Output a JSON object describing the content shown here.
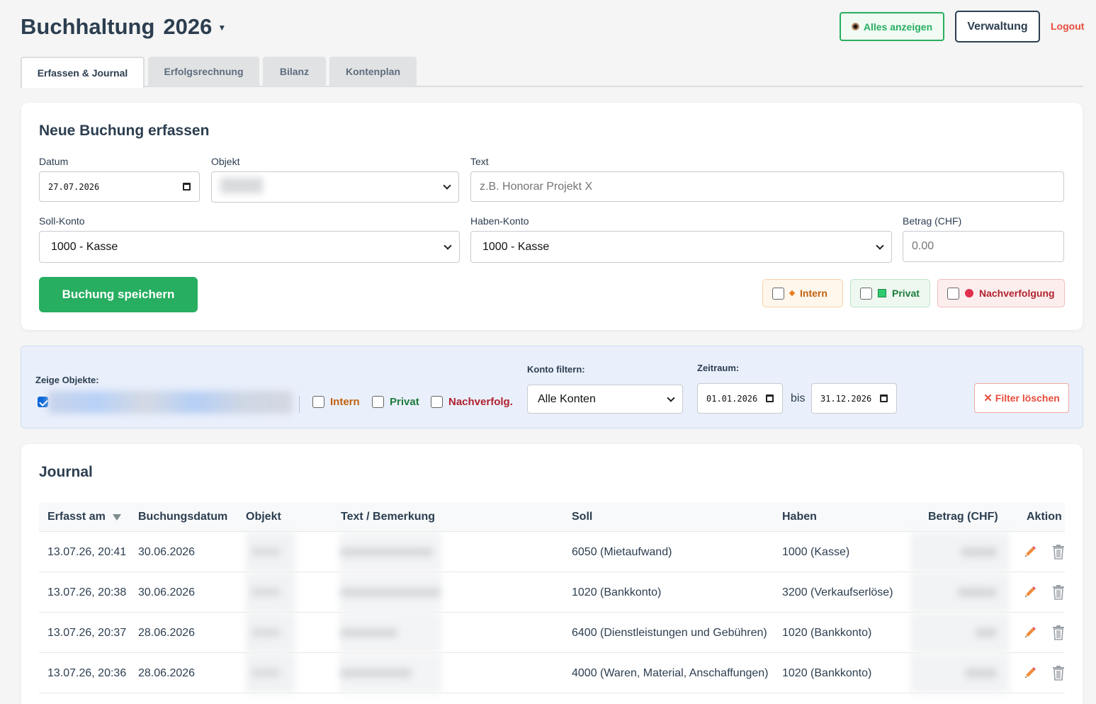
{
  "header": {
    "title": "Buchhaltung",
    "year": "2026",
    "show_all_label": "Alles anzeigen",
    "admin_label": "Verwaltung",
    "logout_label": "Logout"
  },
  "tabs": [
    {
      "label": "Erfassen & Journal",
      "active": true
    },
    {
      "label": "Erfolgsrechnung",
      "active": false
    },
    {
      "label": "Bilanz",
      "active": false
    },
    {
      "label": "Kontenplan",
      "active": false
    }
  ],
  "form": {
    "title": "Neue Buchung erfassen",
    "date_label": "Datum",
    "date_value": "27.07.2026",
    "object_label": "Objekt",
    "text_label": "Text",
    "text_placeholder": "z.B. Honorar Projekt X",
    "debit_label": "Soll-Konto",
    "debit_value": "1000 - Kasse",
    "credit_label": "Haben-Konto",
    "credit_value": "1000 - Kasse",
    "amount_label": "Betrag (CHF)",
    "amount_placeholder": "0.00",
    "save_label": "Buchung speichern",
    "flags": [
      {
        "label": "Intern",
        "color": "#c0620f",
        "bg": "#fff6ec",
        "border": "#f6d3a8"
      },
      {
        "label": "Privat",
        "color": "#1e7b3c",
        "bg": "#eef8f0",
        "border": "#bfe3c8"
      },
      {
        "label": "Nachverfolgung",
        "color": "#b0222e",
        "bg": "#fdeeee",
        "border": "#f2bcbc"
      }
    ]
  },
  "filter": {
    "objects_label": "Zeige Objekte:",
    "intern_label": "Intern",
    "privat_label": "Privat",
    "followup_label": "Nachverfolg.",
    "account_label": "Konto filtern:",
    "account_value": "Alle Konten",
    "period_label": "Zeitraum:",
    "from_date": "01.01.2026",
    "to_label": "bis",
    "to_date": "31.12.2026",
    "clear_label": "Filter löschen"
  },
  "journal": {
    "title": "Journal",
    "columns": [
      "Erfasst am",
      "Buchungsdatum",
      "Objekt",
      "Text / Bemerkung",
      "Soll",
      "Haben",
      "Betrag (CHF)",
      "Aktion"
    ],
    "rows": [
      {
        "created": "13.07.26, 20:41",
        "date": "30.06.2026",
        "debit": "6050 (Mietaufwand)",
        "credit": "1000 (Kasse)"
      },
      {
        "created": "13.07.26, 20:38",
        "date": "30.06.2026",
        "debit": "1020 (Bankkonto)",
        "credit": "3200 (Verkaufserlöse)"
      },
      {
        "created": "13.07.26, 20:37",
        "date": "28.06.2026",
        "debit": "6400 (Dienstleistungen und Gebühren)",
        "credit": "1020 (Bankkonto)"
      },
      {
        "created": "13.07.26, 20:36",
        "date": "28.06.2026",
        "debit": "4000 (Waren, Material, Anschaffungen)",
        "credit": "1020 (Bankkonto)"
      }
    ]
  },
  "colors": {
    "accent_green": "#27ae60",
    "danger_red": "#e74c3c",
    "text_dark": "#2c3e50"
  }
}
